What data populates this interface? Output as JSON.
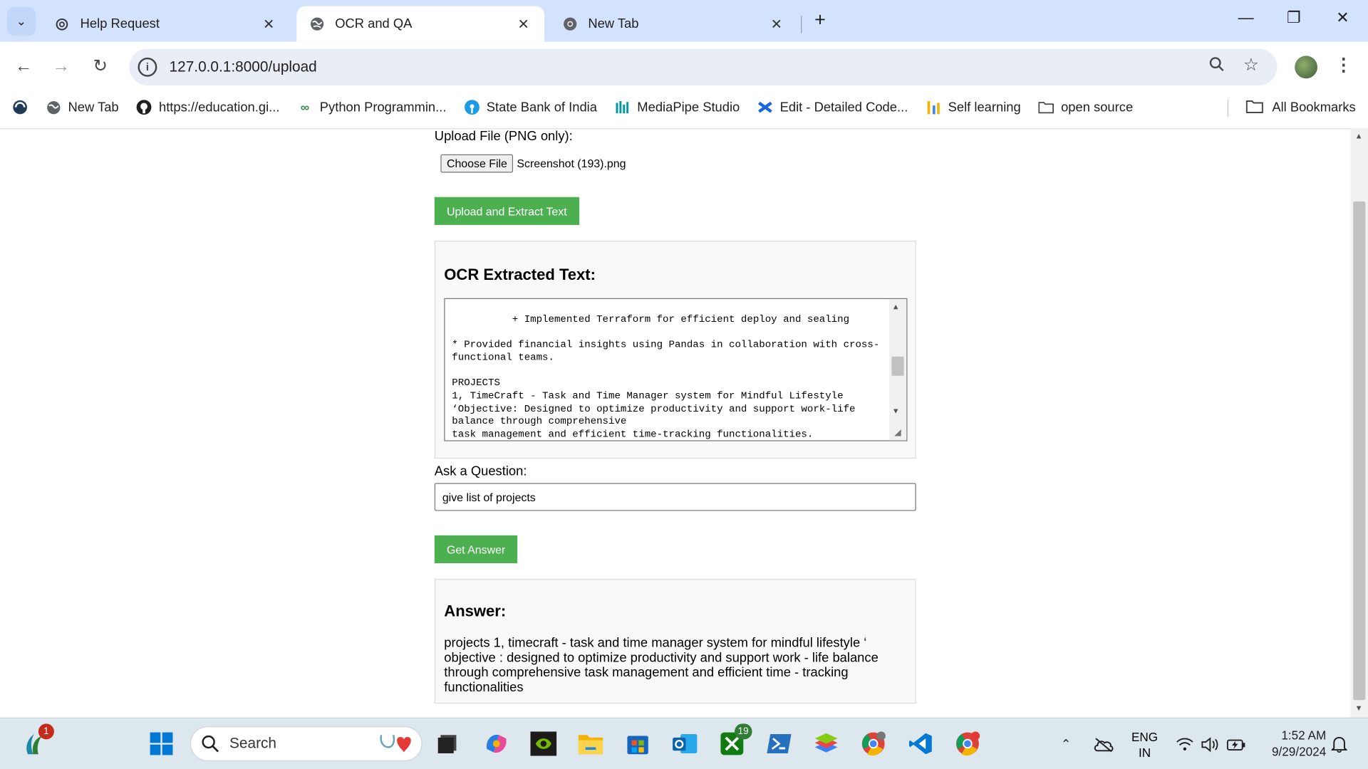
{
  "browser": {
    "tabs": [
      {
        "label": "Help Request",
        "icon": "openai-icon",
        "active": false
      },
      {
        "label": "OCR and QA",
        "icon": "globe-icon",
        "active": true
      },
      {
        "label": "New Tab",
        "icon": "chrome-icon",
        "active": false
      }
    ],
    "url": "127.0.0.1:8000/upload",
    "bookmarks": [
      {
        "label": "New Tab"
      },
      {
        "label": "https://education.gi..."
      },
      {
        "label": "Python Programmin..."
      },
      {
        "label": "State Bank of India"
      },
      {
        "label": "MediaPipe Studio"
      },
      {
        "label": "Edit - Detailed Code..."
      },
      {
        "label": "Self learning"
      },
      {
        "label": "open source"
      }
    ],
    "all_bookmarks": "All Bookmarks"
  },
  "page": {
    "upload_label": "Upload File (PNG only):",
    "choose_file": "Choose File",
    "file_name": "Screenshot (193).png",
    "upload_button": "Upload and Extract Text",
    "ocr_heading": "OCR Extracted Text:",
    "ocr_text": "+ Implemented Terraform for efficient deploy and sealing\n\n* Provided financial insights using Pandas in collaboration with cross-\nfunctional teams.\n\nPROJECTS\n1, TimeCraft - Task and Time Manager system for Mindful Lifestyle\n‘Objective: Designed to optimize productivity and support work-life\nbalance through comprehensive\ntask management and efficient time-tracking functionalities.",
    "question_label": "Ask a Question:",
    "question_value": "give list of projects",
    "answer_button": "Get Answer",
    "answer_heading": "Answer:",
    "answer_text": "projects 1, timecraft - task and time manager system for mindful lifestyle ‘ objective : designed to optimize productivity and support work - life balance through comprehensive task management and efficient time - tracking functionalities"
  },
  "taskbar": {
    "search_placeholder": "Search",
    "widgets_badge": "1",
    "xbox_badge": "19",
    "lang_top": "ENG",
    "lang_bottom": "IN",
    "time": "1:52 AM",
    "date": "9/29/2024"
  },
  "colors": {
    "tabstrip": "#d3e3fd",
    "accent_green": "#4caf50",
    "taskbar": "#dde7ee"
  }
}
